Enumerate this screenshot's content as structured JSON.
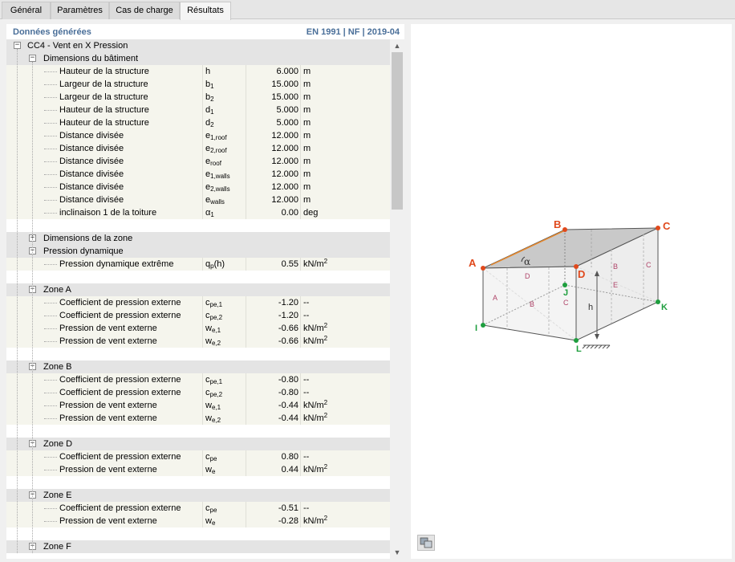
{
  "tabs": [
    {
      "label": "Général",
      "active": false
    },
    {
      "label": "Paramètres",
      "active": false
    },
    {
      "label": "Cas de charge",
      "active": false
    },
    {
      "label": "Résultats",
      "active": true
    }
  ],
  "panel": {
    "title": "Données générées",
    "standard": "EN 1991 | NF | 2019-04"
  },
  "tree": {
    "root": "CC4 - Vent en X Pression",
    "building_dimensions": {
      "label": "Dimensions du bâtiment",
      "items": [
        {
          "label": "Hauteur de la structure",
          "sym": "h",
          "sub": "",
          "value": "6.000",
          "unit": "m",
          "sup": ""
        },
        {
          "label": "Largeur de la structure",
          "sym": "b",
          "sub": "1",
          "value": "15.000",
          "unit": "m",
          "sup": ""
        },
        {
          "label": "Largeur de la structure",
          "sym": "b",
          "sub": "2",
          "value": "15.000",
          "unit": "m",
          "sup": ""
        },
        {
          "label": "Hauteur de la structure",
          "sym": "d",
          "sub": "1",
          "value": "5.000",
          "unit": "m",
          "sup": ""
        },
        {
          "label": "Hauteur de la structure",
          "sym": "d",
          "sub": "2",
          "value": "5.000",
          "unit": "m",
          "sup": ""
        },
        {
          "label": "Distance divisée",
          "sym": "e",
          "sub": "1,roof",
          "value": "12.000",
          "unit": "m",
          "sup": ""
        },
        {
          "label": "Distance divisée",
          "sym": "e",
          "sub": "2,roof",
          "value": "12.000",
          "unit": "m",
          "sup": ""
        },
        {
          "label": "Distance divisée",
          "sym": "e",
          "sub": "roof",
          "value": "12.000",
          "unit": "m",
          "sup": ""
        },
        {
          "label": "Distance divisée",
          "sym": "e",
          "sub": "1,walls",
          "value": "12.000",
          "unit": "m",
          "sup": ""
        },
        {
          "label": "Distance divisée",
          "sym": "e",
          "sub": "2,walls",
          "value": "12.000",
          "unit": "m",
          "sup": ""
        },
        {
          "label": "Distance divisée",
          "sym": "e",
          "sub": "walls",
          "value": "12.000",
          "unit": "m",
          "sup": ""
        },
        {
          "label": "inclinaison 1 de la toiture",
          "sym": "α",
          "sub": "1",
          "value": "0.00",
          "unit": "deg",
          "sup": ""
        }
      ]
    },
    "zone_dimensions": {
      "label": "Dimensions de la zone"
    },
    "dynamic_pressure": {
      "label": "Pression dynamique",
      "items": [
        {
          "label": "Pression dynamique extrême",
          "sym": "q",
          "sub": "p",
          "sym_tail": "(h)",
          "value": "0.55",
          "unit": "kN/m",
          "sup": "2"
        }
      ]
    },
    "zones": [
      {
        "label": "Zone A",
        "items": [
          {
            "label": "Coefficient de pression externe",
            "sym": "c",
            "sub": "pe,1",
            "value": "-1.20",
            "unit": "--",
            "sup": ""
          },
          {
            "label": "Coefficient de pression externe",
            "sym": "c",
            "sub": "pe,2",
            "value": "-1.20",
            "unit": "--",
            "sup": ""
          },
          {
            "label": "Pression de vent externe",
            "sym": "w",
            "sub": "e,1",
            "value": "-0.66",
            "unit": "kN/m",
            "sup": "2"
          },
          {
            "label": "Pression de vent externe",
            "sym": "w",
            "sub": "e,2",
            "value": "-0.66",
            "unit": "kN/m",
            "sup": "2"
          }
        ]
      },
      {
        "label": "Zone B",
        "items": [
          {
            "label": "Coefficient de pression externe",
            "sym": "c",
            "sub": "pe,1",
            "value": "-0.80",
            "unit": "--",
            "sup": ""
          },
          {
            "label": "Coefficient de pression externe",
            "sym": "c",
            "sub": "pe,2",
            "value": "-0.80",
            "unit": "--",
            "sup": ""
          },
          {
            "label": "Pression de vent externe",
            "sym": "w",
            "sub": "e,1",
            "value": "-0.44",
            "unit": "kN/m",
            "sup": "2"
          },
          {
            "label": "Pression de vent externe",
            "sym": "w",
            "sub": "e,2",
            "value": "-0.44",
            "unit": "kN/m",
            "sup": "2"
          }
        ]
      },
      {
        "label": "Zone D",
        "items": [
          {
            "label": "Coefficient de pression externe",
            "sym": "c",
            "sub": "pe",
            "value": "0.80",
            "unit": "--",
            "sup": ""
          },
          {
            "label": "Pression de vent externe",
            "sym": "w",
            "sub": "e",
            "value": "0.44",
            "unit": "kN/m",
            "sup": "2"
          }
        ]
      },
      {
        "label": "Zone E",
        "items": [
          {
            "label": "Coefficient de pression externe",
            "sym": "c",
            "sub": "pe",
            "value": "-0.51",
            "unit": "--",
            "sup": ""
          },
          {
            "label": "Pression de vent externe",
            "sym": "w",
            "sub": "e",
            "value": "-0.28",
            "unit": "kN/m",
            "sup": "2"
          }
        ]
      },
      {
        "label": "Zone F",
        "items": []
      }
    ]
  },
  "figure": {
    "corners": {
      "A": "A",
      "B": "B",
      "C": "C",
      "D": "D",
      "I": "I",
      "J": "J",
      "K": "K",
      "L": "L"
    },
    "zones": {
      "A": "A",
      "B": "B",
      "C": "C",
      "D": "D",
      "E": "E"
    },
    "height_label": "h",
    "angle_label": "α",
    "colors": {
      "red_corner": "#e0491c",
      "green_corner": "#1e9e3e",
      "zone_text": "#b0466a",
      "slope_line": "#e8892c"
    }
  },
  "icons": {
    "graphic_options": "graphic-options-icon",
    "scroll_up": "chevron-up-icon",
    "scroll_down": "chevron-down-icon"
  }
}
